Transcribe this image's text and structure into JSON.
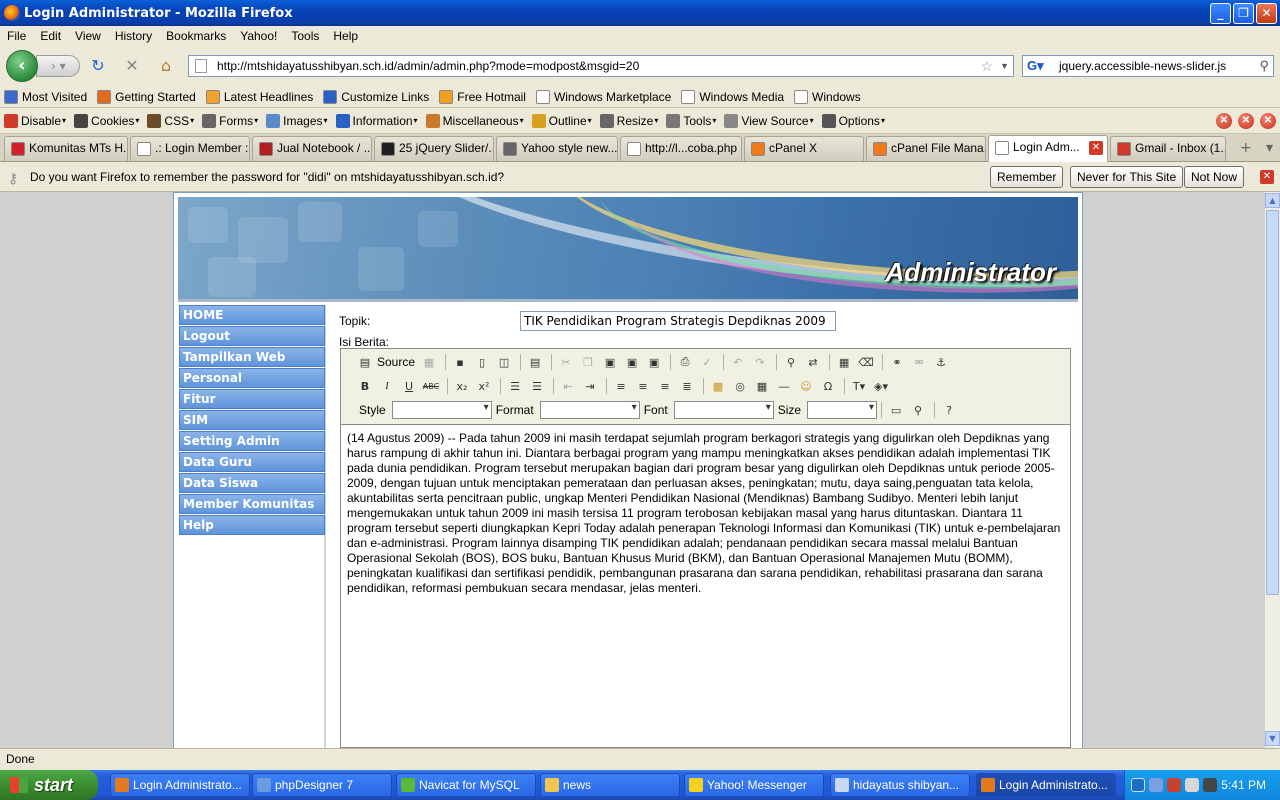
{
  "window": {
    "title": "Login Administrator - Mozilla Firefox"
  },
  "menu": [
    "File",
    "Edit",
    "View",
    "History",
    "Bookmarks",
    "Yahoo!",
    "Tools",
    "Help"
  ],
  "nav": {
    "url": "http://mtshidayatusshibyan.sch.id/admin/admin.php?mode=modpost&msgid=20",
    "search_value": "jquery.accessible-news-slider.js"
  },
  "bookmarks": [
    {
      "label": "Most Visited",
      "color": "#3a6ad0"
    },
    {
      "label": "Getting Started",
      "color": "#e36b1e"
    },
    {
      "label": "Latest Headlines",
      "color": "#f2a12b"
    },
    {
      "label": "Customize Links",
      "color": "#2a5fc8"
    },
    {
      "label": "Free Hotmail",
      "color": "#f0a020"
    },
    {
      "label": "Windows Marketplace",
      "color": "#ffffff"
    },
    {
      "label": "Windows Media",
      "color": "#ffffff"
    },
    {
      "label": "Windows",
      "color": "#ffffff"
    }
  ],
  "webdev": [
    {
      "label": "Disable",
      "color": "#d03a28"
    },
    {
      "label": "Cookies",
      "color": "#444444"
    },
    {
      "label": "CSS",
      "color": "#6a4c2a"
    },
    {
      "label": "Forms",
      "color": "#666666"
    },
    {
      "label": "Images",
      "color": "#5a8ac8"
    },
    {
      "label": "Information",
      "color": "#2a62c4"
    },
    {
      "label": "Miscellaneous",
      "color": "#c87a2a"
    },
    {
      "label": "Outline",
      "color": "#d8a020"
    },
    {
      "label": "Resize",
      "color": "#666666"
    },
    {
      "label": "Tools",
      "color": "#777777"
    },
    {
      "label": "View Source",
      "color": "#888888"
    },
    {
      "label": "Options",
      "color": "#555555"
    }
  ],
  "tabs": [
    {
      "label": "Komunitas MTs H...",
      "color": "#d0202a"
    },
    {
      "label": ".: Login Member :.",
      "color": "#ffffff"
    },
    {
      "label": "Jual Notebook / ...",
      "color": "#b02020"
    },
    {
      "label": "25 jQuery Slider/...",
      "color": "#202020"
    },
    {
      "label": "Yahoo style new...",
      "color": "#666666"
    },
    {
      "label": "http://l...coba.php",
      "color": "#ffffff"
    },
    {
      "label": "cPanel X",
      "color": "#f07a1a"
    },
    {
      "label": "cPanel File Mana...",
      "color": "#f07a1a"
    },
    {
      "label": "Login Adm...",
      "color": "#ffffff"
    },
    {
      "label": "Gmail - Inbox (1...",
      "color": "#d03a28"
    }
  ],
  "notification": {
    "message": "Do you want Firefox to remember the password for \"didi\" on mtshidayatusshibyan.sch.id?",
    "remember": "Remember",
    "never": "Never for This Site",
    "not_now": "Not Now"
  },
  "page": {
    "banner_title": "Administrator",
    "sidebar": [
      "HOME",
      "Logout",
      "Tampilkan Web",
      "Personal",
      "Fitur",
      "SIM",
      "Setting Admin",
      "Data Guru",
      "Data Siswa",
      "Member Komunitas",
      "Help"
    ],
    "topik_label": "Topik:",
    "topik_value": "TIK Pendidikan Program Strategis Depdiknas 2009",
    "isi_label": "Isi Berita:",
    "editor": {
      "source_label": "Source",
      "style_label": "Style",
      "format_label": "Format",
      "font_label": "Font",
      "size_label": "Size",
      "content": "(14 Agustus 2009) -- Pada tahun 2009 ini masih terdapat sejumlah program berkagori strategis yang digulirkan oleh Depdiknas yang harus rampung di akhir tahun ini. Diantara berbagai program yang mampu meningkatkan akses pendidikan adalah implementasi TIK pada dunia pendidikan. Program tersebut merupakan bagian dari program besar yang digulirkan oleh Depdiknas untuk periode 2005-2009, dengan tujuan untuk menciptakan pemerataan dan perluasan akses, peningkatan; mutu, daya saing,penguatan tata kelola, akuntabilitas serta pencitraan public, ungkap Menteri Pendidikan Nasional (Mendiknas) Bambang Sudibyo. Menteri lebih lanjut mengemukakan untuk tahun 2009 ini masih tersisa 11 program terobosan kebijakan masal yang harus dituntaskan. Diantara 11 program tersebut seperti diungkapkan Kepri Today adalah penerapan Teknologi Informasi dan Komunikasi (TIK) untuk e-pembelajaran dan e-administrasi. Program lainnya disamping TIK pendidikan adalah; pendanaan pendidikan secara massal melalui Bantuan Operasional Sekolah (BOS), BOS buku, Bantuan Khusus Murid (BKM), dan Bantuan Operasional Manajemen Mutu (BOMM), peningkatan kualifikasi dan sertifikasi pendidik, pembangunan prasarana dan sarana pendidikan, rehabilitasi prasarana dan sarana pendidikan, reformasi pembukuan secara mendasar, jelas menteri."
    }
  },
  "status": "Done",
  "taskbar": {
    "start": "start",
    "tasks": [
      {
        "label": "Login Administrato...",
        "color": "#e37a1e"
      },
      {
        "label": "phpDesigner 7",
        "color": "#6a9ae0"
      },
      {
        "label": "Navicat for MySQL",
        "color": "#5ab83c"
      },
      {
        "label": "news",
        "color": "#f0c850"
      },
      {
        "label": "Yahoo! Messenger",
        "color": "#f4d020"
      },
      {
        "label": "hidayatus shibyan...",
        "color": "#c8d8f0"
      },
      {
        "label": "Login Administrato...",
        "color": "#e37a1e"
      }
    ],
    "clock": "5:41 PM"
  }
}
